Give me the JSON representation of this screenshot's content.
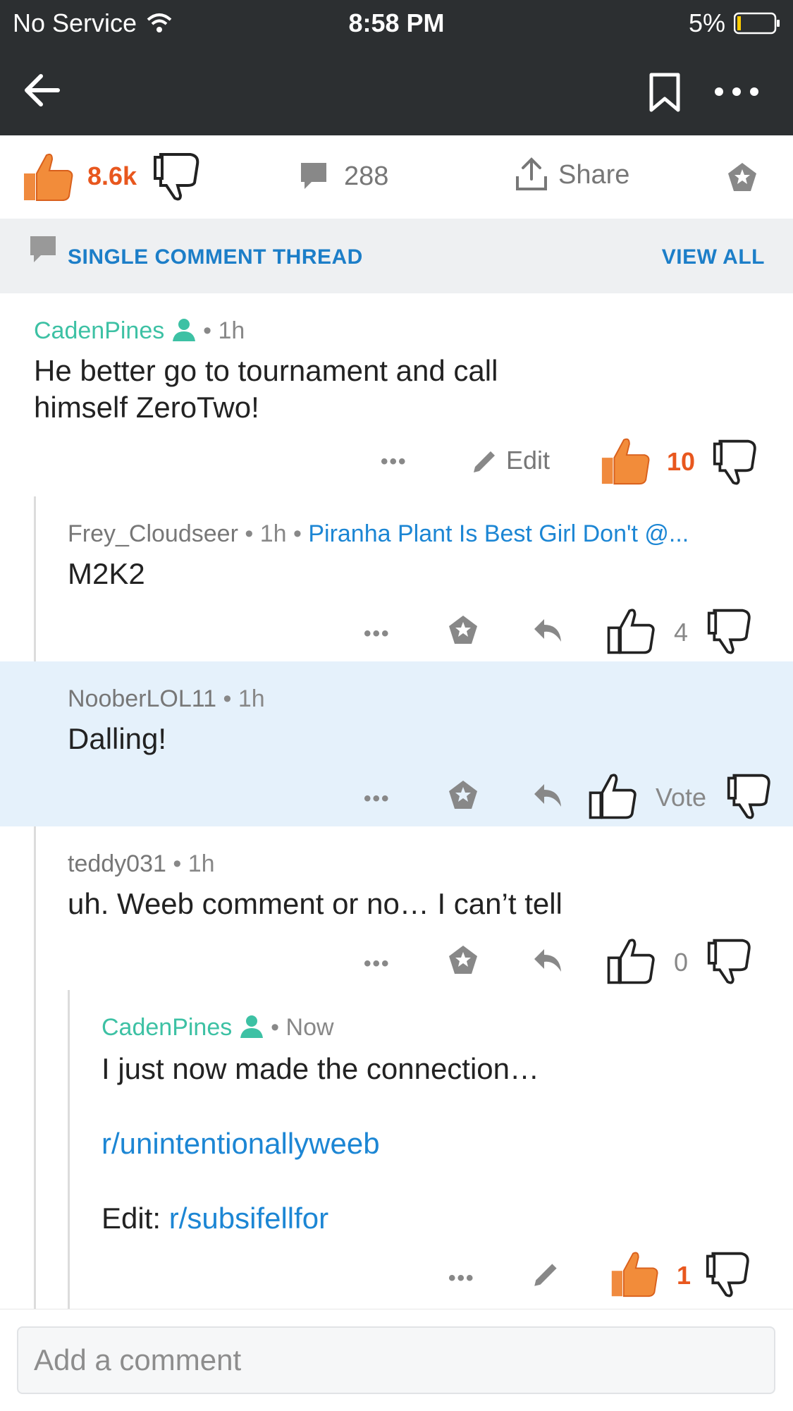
{
  "status_bar": {
    "carrier": "No Service",
    "time": "8:58 PM",
    "battery": "5%"
  },
  "post_actions": {
    "upvotes": "8.6k",
    "comments": "288",
    "share": "Share"
  },
  "thread_bar": {
    "label": "SINGLE COMMENT THREAD",
    "view_all": "VIEW ALL"
  },
  "comments": [
    {
      "author": "CadenPines",
      "age": "1h",
      "text_lines": [
        "He better go to tournament and call",
        "himself ZeroTwo!"
      ],
      "edit_label": "Edit",
      "score": "10"
    },
    {
      "author": "Frey_Cloudseer",
      "age": "1h",
      "flair": "Piranha Plant Is Best Girl Don't @...",
      "text": "M2K2",
      "score": "4"
    },
    {
      "author": "NooberLOL11",
      "age": "1h",
      "text": "Dalling!",
      "score": "Vote"
    },
    {
      "author": "teddy031",
      "age": "1h",
      "text": "uh. Weeb comment or no… I can’t tell",
      "score": "0"
    },
    {
      "author": "CadenPines",
      "age": "Now",
      "text": "I just now made the connection…",
      "link1": "r/unintentionallyweeb",
      "edit_prefix": "Edit:",
      "link2": "r/subsifellfor",
      "score": "1"
    }
  ],
  "composer": {
    "placeholder": "Add a comment"
  },
  "colors": {
    "upvote_orange": "#e8571e",
    "op_green": "#3dc1a4",
    "link_blue": "#1c86d4",
    "highlight": "#e5f1fb"
  }
}
